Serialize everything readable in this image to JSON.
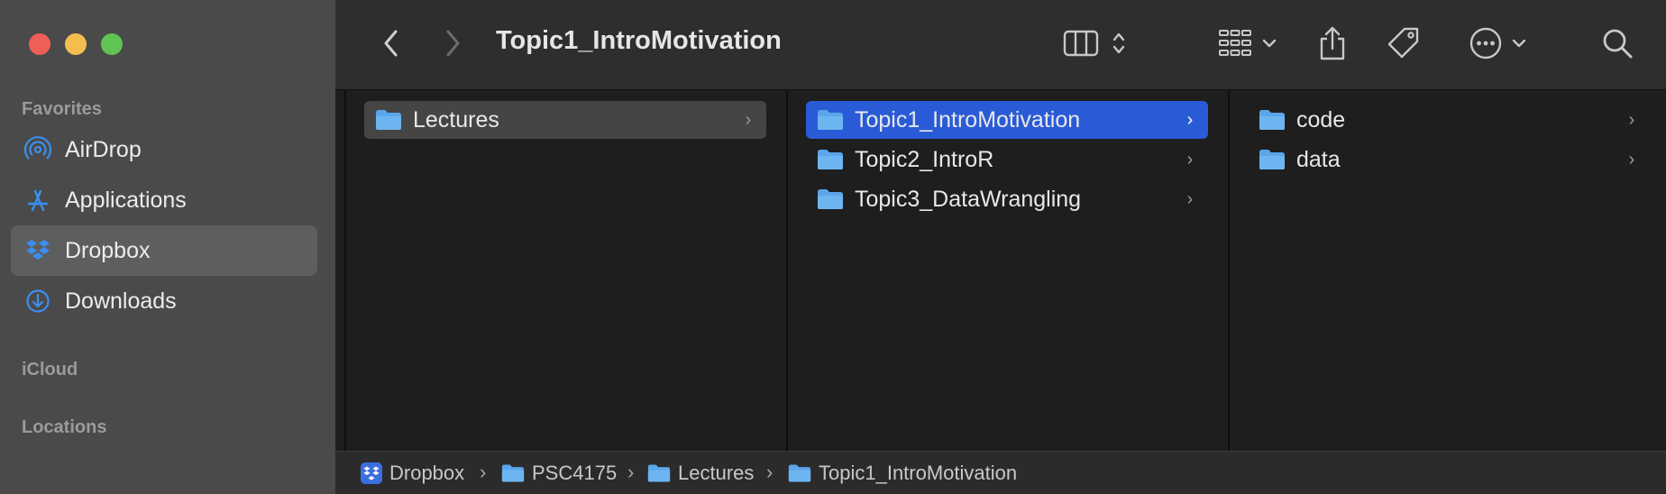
{
  "window": {
    "title": "Topic1_IntroMotivation"
  },
  "sidebar": {
    "sections": [
      {
        "heading": "Favorites"
      },
      {
        "heading": "iCloud"
      },
      {
        "heading": "Locations"
      }
    ],
    "items": [
      {
        "label": "AirDrop",
        "icon": "airdrop-icon"
      },
      {
        "label": "Applications",
        "icon": "applications-icon"
      },
      {
        "label": "Dropbox",
        "icon": "dropbox-icon",
        "selected": true
      },
      {
        "label": "Downloads",
        "icon": "downloads-icon"
      }
    ]
  },
  "toolbar": {
    "back": "chevron-left-icon",
    "forward": "chevron-right-icon",
    "view_mode": "columns-view-icon",
    "group": "group-grid-icon",
    "share": "share-icon",
    "tags": "tag-icon",
    "more": "ellipsis-circle-icon",
    "search": "search-icon"
  },
  "columns": [
    {
      "rows": [
        {
          "name": "Lectures",
          "state": "inactive-selected"
        }
      ]
    },
    {
      "rows": [
        {
          "name": "Topic1_IntroMotivation",
          "state": "active"
        },
        {
          "name": "Topic2_IntroR"
        },
        {
          "name": "Topic3_DataWrangling"
        }
      ]
    },
    {
      "rows": [
        {
          "name": "code"
        },
        {
          "name": "data"
        }
      ]
    }
  ],
  "pathbar": [
    {
      "label": "Dropbox",
      "icon": "dropbox-icon"
    },
    {
      "label": "PSC4175",
      "icon": "folder-icon"
    },
    {
      "label": "Lectures",
      "icon": "folder-icon"
    },
    {
      "label": "Topic1_IntroMotivation",
      "icon": "folder-icon"
    }
  ],
  "colors": {
    "accent": "#2a5bd7",
    "folder": "#5aa6ea",
    "sidebar_icon": "#3b8ff0"
  }
}
